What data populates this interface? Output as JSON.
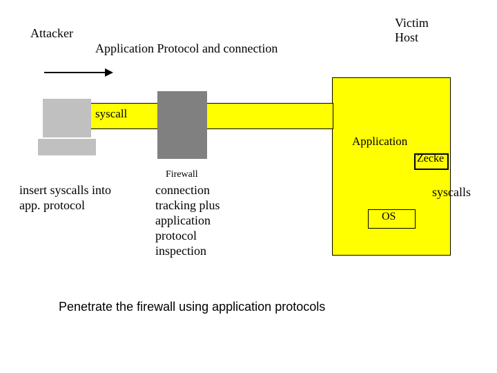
{
  "labels": {
    "attacker": "Attacker",
    "victim_host_line1": "Victim",
    "victim_host_line2": "Host",
    "app_protocol": "Application Protocol and connection",
    "syscall": "syscall",
    "application": "Application",
    "zecke": "Zecke",
    "firewall": "Firewall",
    "insert_syscalls_line1": "insert syscalls into",
    "insert_syscalls_line2": "app. protocol",
    "firewall_desc_line1": "connection",
    "firewall_desc_line2": "tracking plus",
    "firewall_desc_line3": "application",
    "firewall_desc_line4": "protocol",
    "firewall_desc_line5": "inspection",
    "syscalls": "syscalls",
    "os": "OS",
    "caption": "Penetrate the firewall using application protocols"
  }
}
